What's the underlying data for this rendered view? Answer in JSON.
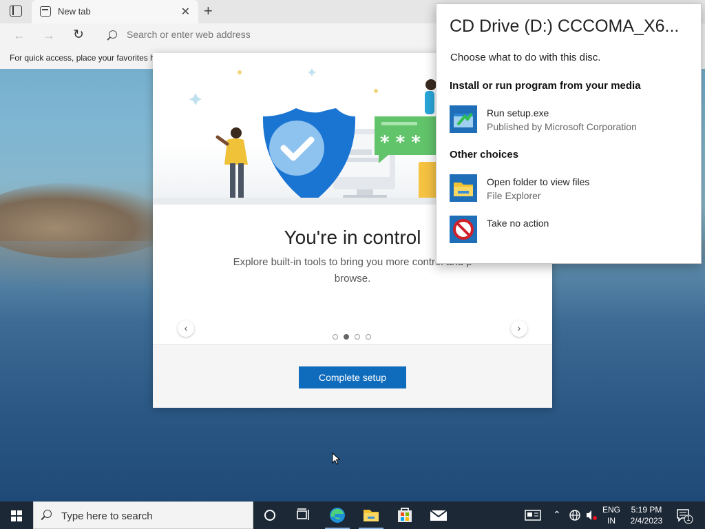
{
  "browser": {
    "tab_title": "New tab",
    "address_placeholder": "Search or enter web address",
    "favorites_hint": "For quick access, place your favorites h"
  },
  "welcome": {
    "title": "You're in control",
    "description": "Explore built-in tools to bring you more control and p",
    "description_line2": "browse.",
    "complete_button": "Complete setup",
    "carousel_page": 2,
    "carousel_total": 4
  },
  "autoplay": {
    "title": "CD Drive (D:) CCCOMA_X6...",
    "subtitle": "Choose what to do with this disc.",
    "section_install": "Install or run program from your media",
    "section_other": "Other choices",
    "options": [
      {
        "title": "Run setup.exe",
        "subtitle": "Published by Microsoft Corporation",
        "icon": "setup-exe-icon"
      },
      {
        "title": "Open folder to view files",
        "subtitle": "File Explorer",
        "icon": "folder-icon"
      },
      {
        "title": "Take no action",
        "subtitle": "",
        "icon": "no-action-icon"
      }
    ]
  },
  "taskbar": {
    "search_placeholder": "Type here to search",
    "language_line1": "ENG",
    "language_line2": "IN",
    "time": "5:19 PM",
    "date": "2/4/2023",
    "notification_count": "1"
  },
  "colors": {
    "accent": "#0f6cbd",
    "taskbar": "#1c2836",
    "shield": "#1a74d2"
  }
}
